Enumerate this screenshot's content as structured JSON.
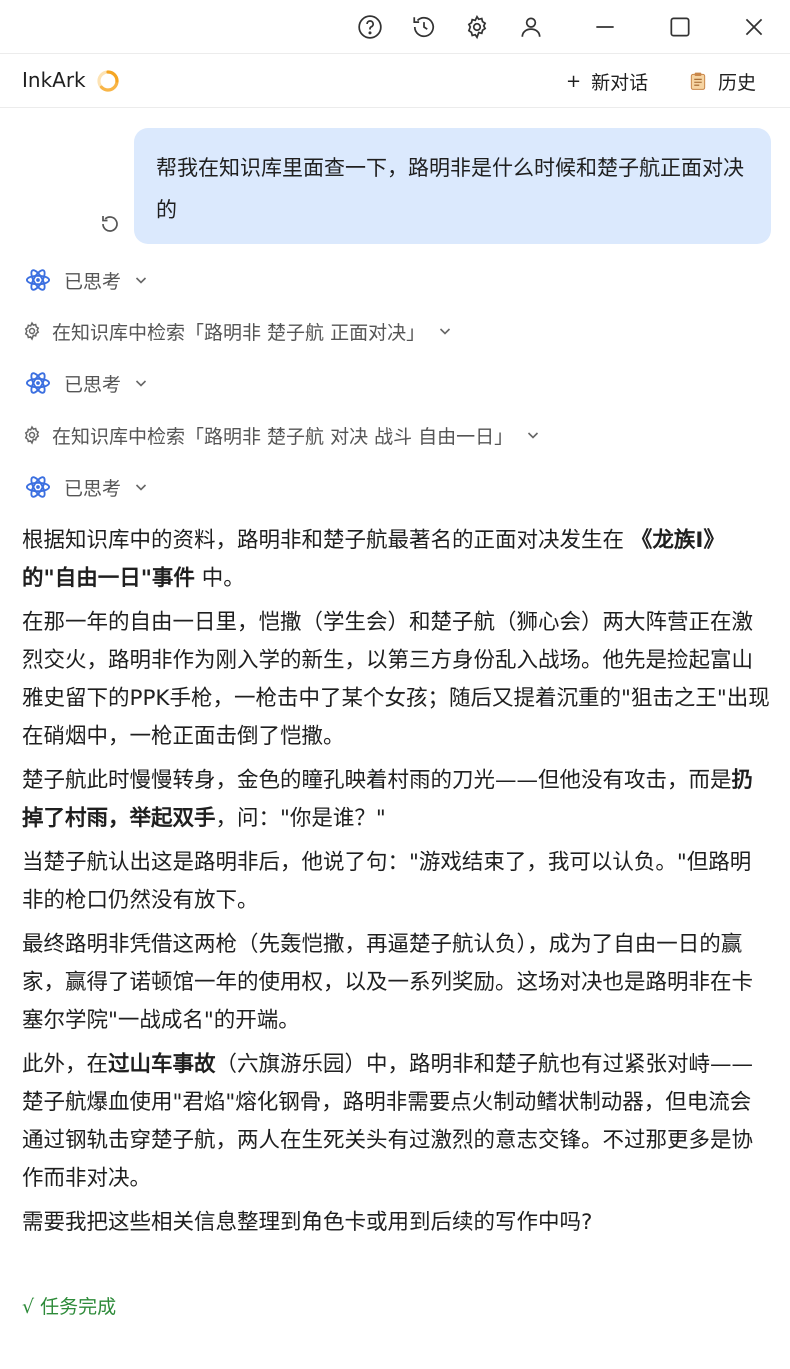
{
  "window": {
    "controls": [
      "help-icon",
      "history-icon",
      "settings-icon",
      "user-icon",
      "minimize-icon",
      "maximize-icon",
      "close-icon"
    ]
  },
  "header": {
    "app_name": "InkArk",
    "new_chat_label": "新对话",
    "history_label": "历史",
    "accent_color": "#f5a623"
  },
  "user_message": {
    "text": "帮我在知识库里面查一下，路明非是什么时候和楚子航正面对决的",
    "bubble_color": "#dbe9fd"
  },
  "steps": [
    {
      "type": "thinking",
      "label": "已思考"
    },
    {
      "type": "search",
      "label": "在知识库中检索「路明非 楚子航 正面对决」"
    },
    {
      "type": "thinking",
      "label": "已思考"
    },
    {
      "type": "search",
      "label": "在知识库中检索「路明非 楚子航 对决 战斗 自由一日」"
    },
    {
      "type": "thinking",
      "label": "已思考"
    }
  ],
  "answer": {
    "p1": {
      "a": "根据知识库中的资料，路明非和楚子航最著名的正面对决发生在 ",
      "b": "《龙族Ⅰ》的\"自由一日\"事件",
      "c": " 中。"
    },
    "p2": "在那一年的自由一日里，恺撒（学生会）和楚子航（狮心会）两大阵营正在激烈交火，路明非作为刚入学的新生，以第三方身份乱入战场。他先是捡起富山雅史留下的PPK手枪，一枪击中了某个女孩；随后又提着沉重的\"狙击之王\"出现在硝烟中，一枪正面击倒了恺撒。",
    "p3": {
      "a": "楚子航此时慢慢转身，金色的瞳孔映着村雨的刀光——但他没有攻击，而是",
      "b": "扔掉了村雨，举起双手",
      "c": "，问：\"你是谁？\""
    },
    "p4": "当楚子航认出这是路明非后，他说了句：\"游戏结束了，我可以认负。\"但路明非的枪口仍然没有放下。",
    "p5": "最终路明非凭借这两枪（先轰恺撒，再逼楚子航认负），成为了自由一日的赢家，赢得了诺顿馆一年的使用权，以及一系列奖励。这场对决也是路明非在卡塞尔学院\"一战成名\"的开端。",
    "p6": {
      "a": "此外，在",
      "b": "过山车事故",
      "c": "（六旗游乐园）中，路明非和楚子航也有过紧张对峙——楚子航爆血使用\"君焰\"熔化钢骨，路明非需要点火制动鳍状制动器，但电流会通过钢轨击穿楚子航，两人在生死关头有过激烈的意志交锋。不过那更多是协作而非对决。"
    },
    "p7": "需要我把这些相关信息整理到角色卡或用到后续的写作中吗?"
  },
  "status": {
    "done_label": "√ 任务完成",
    "done_color": "#2e8b3a"
  }
}
